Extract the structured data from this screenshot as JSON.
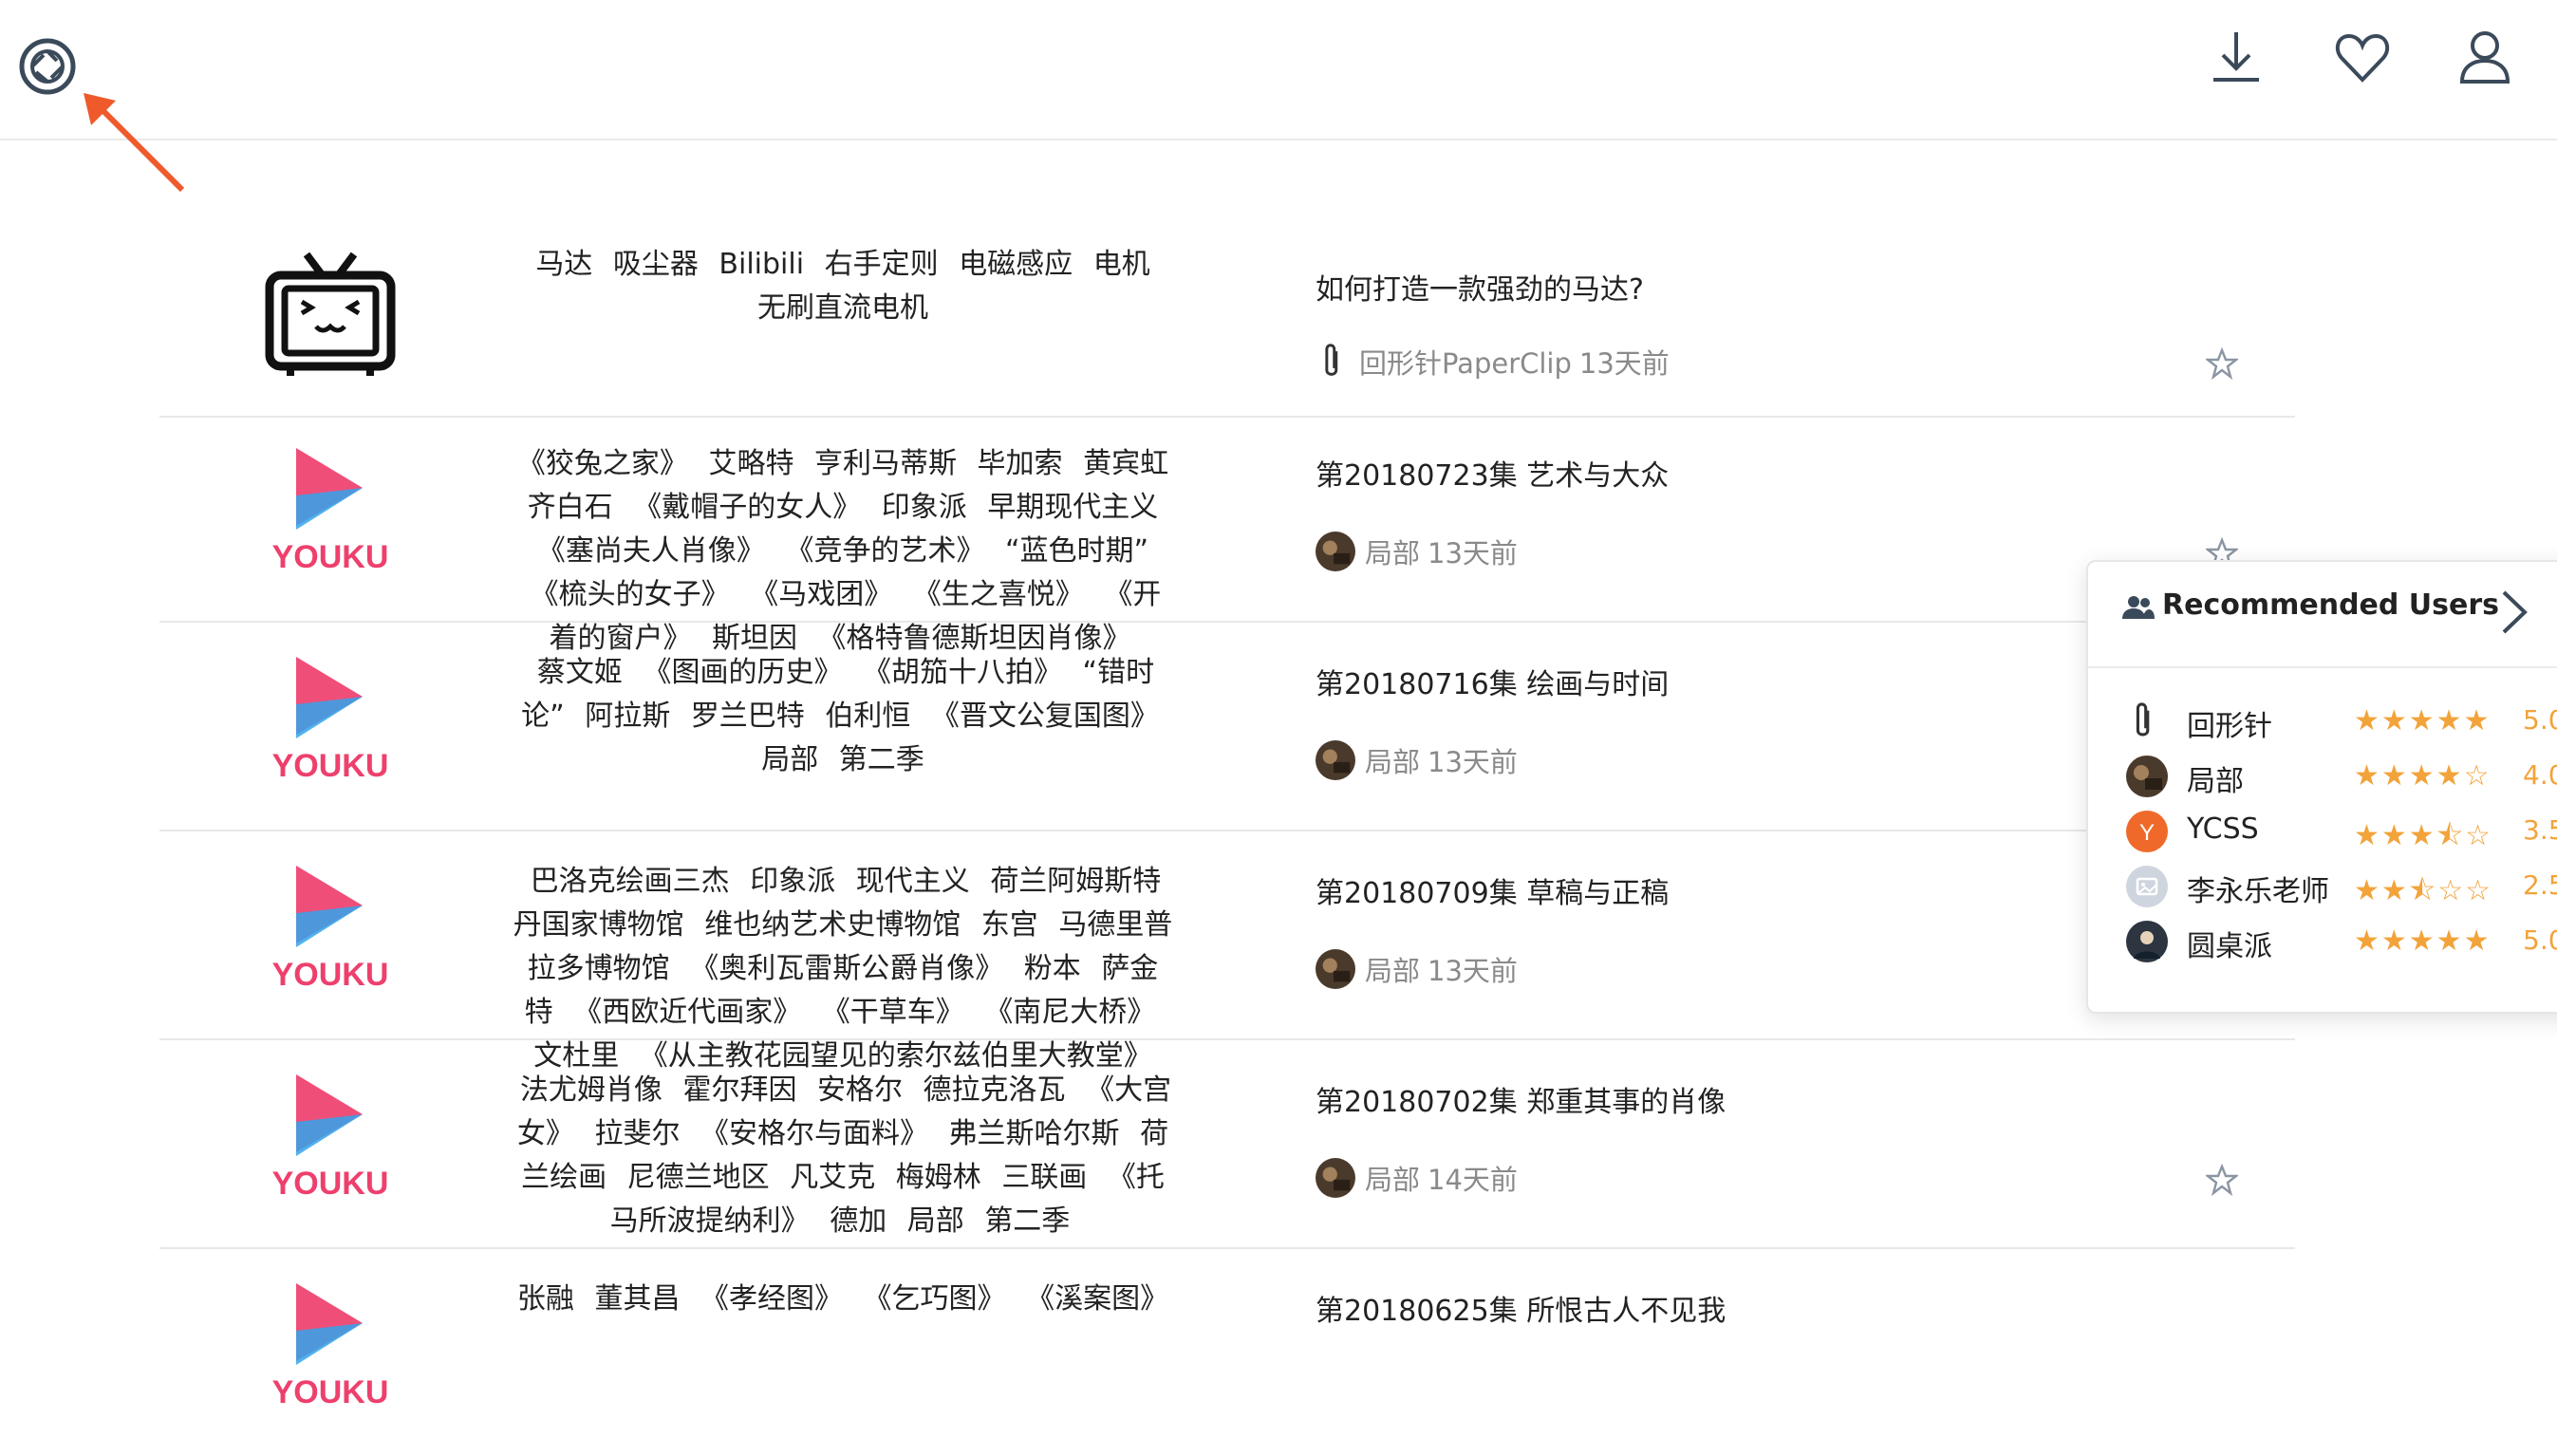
{
  "header": {
    "icons": [
      "aperture-logo-icon",
      "download-icon",
      "heart-icon",
      "user-icon"
    ]
  },
  "rows": [
    {
      "thumb": "bilibili",
      "tags": [
        "马达",
        "吸尘器",
        "Bilibili",
        "右手定则",
        "电磁感应",
        "电机",
        "无刷直流电机"
      ],
      "title": "如何打造一款强劲的马达?",
      "author": "回形针PaperClip",
      "time": "13天前",
      "author_avatar": "paperclip"
    },
    {
      "thumb": "youku",
      "tags": [
        "《狡兔之家》",
        "艾略特",
        "亨利马蒂斯",
        "毕加索",
        "黄宾虹",
        "齐白石",
        "《戴帽子的女人》",
        "印象派",
        "早期现代主义",
        "《塞尚夫人肖像》",
        "《竞争的艺术》",
        "“蓝色时期”",
        "《梳头的女子》",
        "《马戏团》",
        "《生之喜悦》",
        "《开着的窗户》",
        "斯坦因",
        "《格特鲁德斯坦因肖像》"
      ],
      "title": "第20180723集 艺术与大众",
      "author": "局部",
      "time": "13天前",
      "author_avatar": "jubu"
    },
    {
      "thumb": "youku",
      "tags": [
        "蔡文姬",
        "《图画的历史》",
        "《胡笳十八拍》",
        "“错时论”",
        "阿拉斯",
        "罗兰巴特",
        "伯利恒",
        "《晋文公复国图》",
        "局部",
        "第二季"
      ],
      "title": "第20180716集 绘画与时间",
      "author": "局部",
      "time": "13天前",
      "author_avatar": "jubu"
    },
    {
      "thumb": "youku",
      "tags": [
        "巴洛克绘画三杰",
        "印象派",
        "现代主义",
        "荷兰阿姆斯特丹国家博物馆",
        "维也纳艺术史博物馆",
        "东宫",
        "马德里普拉多博物馆",
        "《奥利瓦雷斯公爵肖像》",
        "粉本",
        "萨金特",
        "《西欧近代画家》",
        "《干草车》",
        "《南尼大桥》",
        "文杜里",
        "《从主教花园望见的索尔兹伯里大教堂》"
      ],
      "title": "第20180709集 草稿与正稿",
      "author": "局部",
      "time": "13天前",
      "author_avatar": "jubu"
    },
    {
      "thumb": "youku",
      "tags": [
        "法尤姆肖像",
        "霍尔拜因",
        "安格尔",
        "德拉克洛瓦",
        "《大宫女》",
        "拉斐尔",
        "《安格尔与面料》",
        "弗兰斯哈尔斯",
        "荷兰绘画",
        "尼德兰地区",
        "凡艾克",
        "梅姆林",
        "三联画",
        "《托马所波提纳利》",
        "德加",
        "局部",
        "第二季"
      ],
      "title": "第20180702集 郑重其事的肖像",
      "author": "局部",
      "time": "14天前",
      "author_avatar": "jubu"
    },
    {
      "thumb": "youku",
      "tags": [
        "张融",
        "董其昌",
        "《孝经图》",
        "《乞巧图》",
        "《溪案图》"
      ],
      "title": "第20180625集 所恨古人不见我",
      "author": "",
      "time": "",
      "author_avatar": ""
    }
  ],
  "recommended": {
    "title": "Recommended Users",
    "users": [
      {
        "name": "回形针",
        "avatar": "paperclip",
        "stars": "★★★★★",
        "rating": "5.0"
      },
      {
        "name": "局部",
        "avatar": "jubu",
        "stars": "★★★★☆",
        "rating": "4.0"
      },
      {
        "name": "YCSS",
        "avatar": "Y",
        "stars": "★★★⯪☆",
        "rating": "3.5"
      },
      {
        "name": "李永乐老师",
        "avatar": "placeholder",
        "stars": "★★⯪☆☆",
        "rating": "2.5"
      },
      {
        "name": "圆桌派",
        "avatar": "yuanzhuo",
        "stars": "★★★★★",
        "rating": "5.0"
      }
    ]
  },
  "colors": {
    "accent": "#f2a33a",
    "arrow": "#ee5a2b",
    "youku_pink": "#ee3f6d",
    "youku_blue": "#33a4ec",
    "text_muted": "#8a8a8a"
  }
}
